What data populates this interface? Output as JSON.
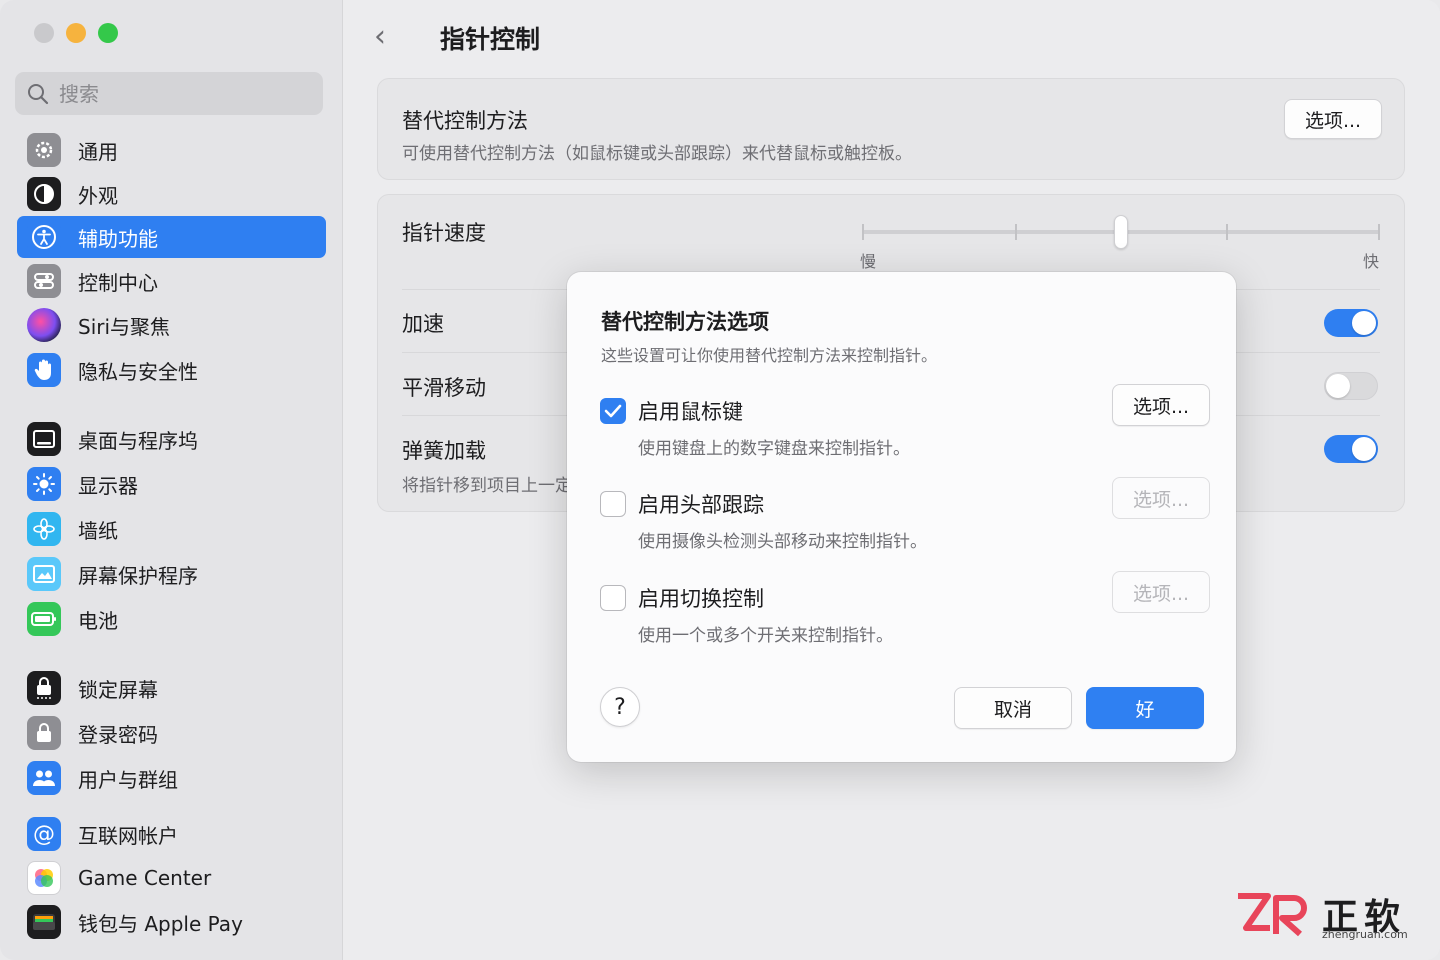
{
  "sidebar": {
    "search_placeholder": "搜索",
    "items": [
      {
        "label": "通用",
        "icon": "gear-icon",
        "color": "#8e8e93"
      },
      {
        "label": "外观",
        "icon": "appearance-icon",
        "color": "#1d1d1f"
      },
      {
        "label": "辅助功能",
        "icon": "accessibility-icon",
        "color": "#2f7ff1",
        "active": true
      },
      {
        "label": "控制中心",
        "icon": "control-center-icon",
        "color": "#8e8e93"
      },
      {
        "label": "Siri与聚焦",
        "icon": "siri-icon",
        "color": "#7d4ef0"
      },
      {
        "label": "隐私与安全性",
        "icon": "hand-icon",
        "color": "#2f7ff1"
      },
      {
        "label": "桌面与程序坞",
        "icon": "dock-icon",
        "color": "#1d1d1f"
      },
      {
        "label": "显示器",
        "icon": "sun-icon",
        "color": "#2f7ff1"
      },
      {
        "label": "墙纸",
        "icon": "flower-icon",
        "color": "#31b6f0"
      },
      {
        "label": "屏幕保护程序",
        "icon": "screensaver-icon",
        "color": "#5ac8fa"
      },
      {
        "label": "电池",
        "icon": "battery-icon",
        "color": "#34c759"
      },
      {
        "label": "锁定屏幕",
        "icon": "lock-screen-icon",
        "color": "#1d1d1f"
      },
      {
        "label": "登录密码",
        "icon": "lock-icon",
        "color": "#8e8e93"
      },
      {
        "label": "用户与群组",
        "icon": "users-icon",
        "color": "#2f7ff1"
      },
      {
        "label": "互联网帐户",
        "icon": "at-icon",
        "color": "#2f7ff1"
      },
      {
        "label": "Game Center",
        "icon": "game-center-icon",
        "color": "#ffffff"
      },
      {
        "label": "钱包与 Apple Pay",
        "icon": "wallet-icon",
        "color": "#1d1d1f"
      }
    ]
  },
  "main": {
    "title": "指针控制",
    "alt_control": {
      "title": "替代控制方法",
      "desc": "可使用替代控制方法（如鼠标键或头部跟踪）来代替鼠标或触控板。",
      "button": "选项..."
    },
    "pointer_speed": {
      "label": "指针速度",
      "slow": "慢",
      "fast": "快",
      "value": 0.5
    },
    "acceleration": {
      "label": "加速",
      "on": true
    },
    "smooth": {
      "label": "平滑移动",
      "on": false
    },
    "spring": {
      "label": "弹簧加载",
      "desc": "将指针移到项目上一定",
      "on": true
    }
  },
  "dialog": {
    "title": "替代控制方法选项",
    "subtitle": "这些设置可让你使用替代控制方法来控制指针。",
    "options": [
      {
        "label": "启用鼠标键",
        "desc": "使用键盘上的数字键盘来控制指针。",
        "checked": true,
        "button": "选项...",
        "enabled": true
      },
      {
        "label": "启用头部跟踪",
        "desc": "使用摄像头检测头部移动来控制指针。",
        "checked": false,
        "button": "选项...",
        "enabled": false
      },
      {
        "label": "启用切换控制",
        "desc": "使用一个或多个开关来控制指针。",
        "checked": false,
        "button": "选项...",
        "enabled": false
      }
    ],
    "help": "?",
    "cancel": "取消",
    "ok": "好"
  },
  "watermark": {
    "text": "正软",
    "url": "zhengruan.com"
  }
}
